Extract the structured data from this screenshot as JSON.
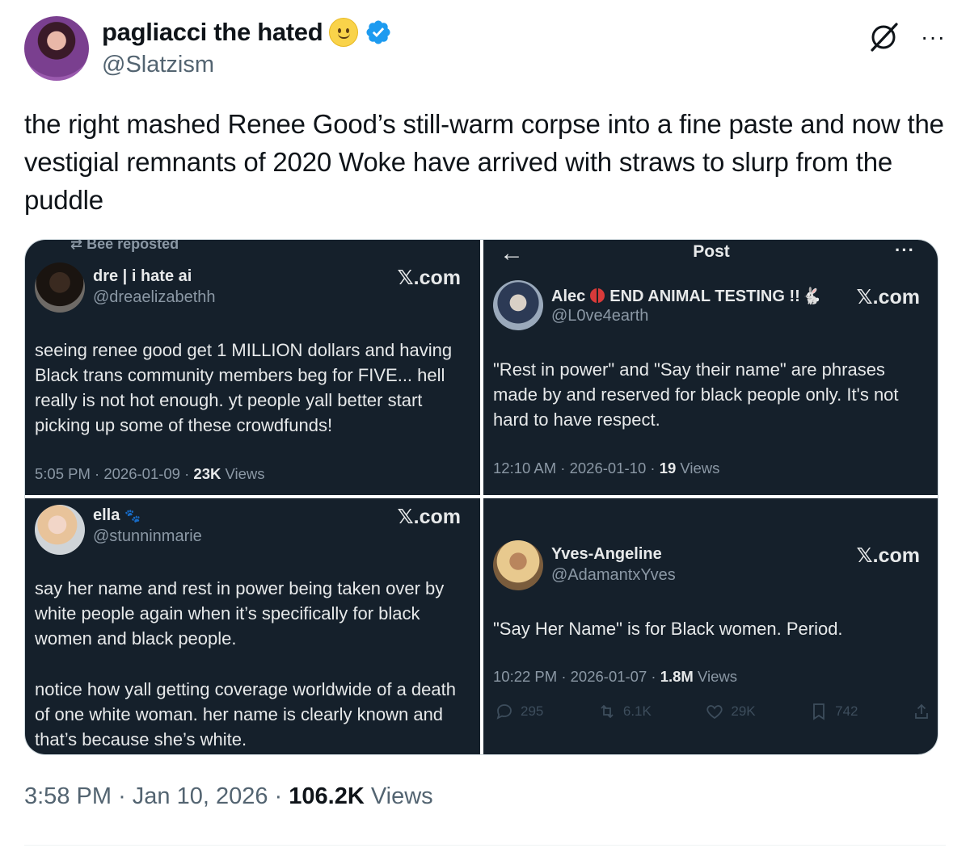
{
  "author": {
    "display_name": "pagliacci the hated",
    "handle": "@Slatzism"
  },
  "tweet": {
    "text": "the right mashed Renee Good’s still-warm corpse into a fine paste and now the vestigial remnants of 2020 Woke have arrived with straws to slurp from the puddle",
    "time": "3:58 PM",
    "date": "Jan 10, 2026",
    "views_count": "106.2K",
    "views_label": "Views"
  },
  "icons": {
    "slash": "grok-slash-icon",
    "more": "more-options-icon",
    "verified": "verified-badge-icon"
  },
  "colors": {
    "panel_bg": "#15202b",
    "verified_blue": "#1d9bf0",
    "muted_text": "#536471"
  },
  "panels": [
    {
      "repost_label": "Bee reposted",
      "name": "dre | i hate ai",
      "handle": "@dreaelizabethh",
      "source": "𝕏.com",
      "text": "seeing renee good get 1 MILLION dollars and having Black trans community members beg for FIVE... hell really is not hot enough. yt people yall better start picking up some of these crowdfunds!",
      "meta_prefix": "5:05 PM · 2026-01-09 · ",
      "views": "23K",
      "views_label": " Views"
    },
    {
      "nav_back": "←",
      "nav_title": "Post",
      "nav_more": "···",
      "name_a": "Alec",
      "name_b": "END ANIMAL TESTING !!",
      "handle": "@L0ve4earth",
      "source": "𝕏.com",
      "text": "\"Rest in power\" and \"Say their name\" are phrases made by and reserved for black people only. It's not hard to have respect.",
      "meta_prefix": "12:10 AM · 2026-01-10 · ",
      "views": "19",
      "views_label": " Views"
    },
    {
      "name": "ella",
      "handle": "@stunninmarie",
      "source": "𝕏.com",
      "text_1": "say her name and rest in power being taken over by white people again when it’s specifically for black women and black people.",
      "text_2": "notice how yall getting coverage worldwide of a death of one white woman. her name is clearly known and that’s because she’s white."
    },
    {
      "name": "Yves-Angeline",
      "handle": "@AdamantxYves",
      "source": "𝕏.com",
      "text": "\"Say Her Name\" is for Black women. Period.",
      "meta_prefix": "10:22 PM · 2026-01-07 · ",
      "views": "1.8M",
      "views_label": " Views",
      "actions": {
        "replies": "295",
        "reposts": "6.1K",
        "likes": "29K",
        "bookmarks": "742"
      }
    }
  ]
}
